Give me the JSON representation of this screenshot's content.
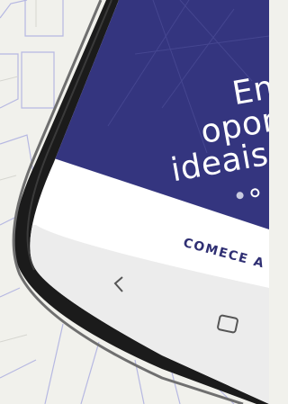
{
  "slide": {
    "line1": "Enc",
    "line2": "oport",
    "line3": "ideais p"
  },
  "pagination": {
    "count": 2,
    "active_index": 1
  },
  "cta": {
    "label": "COMECE A"
  },
  "nav": {
    "back_icon": "back-chevron-icon",
    "home_icon": "home-square-icon"
  },
  "colors": {
    "brand": "#34357f",
    "background": "#f1f1ec",
    "cta_text": "#2f2f73"
  }
}
